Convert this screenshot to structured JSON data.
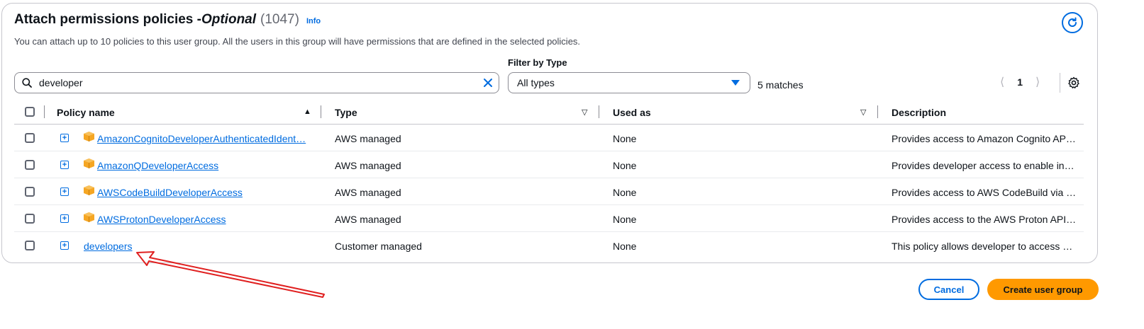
{
  "header": {
    "title": "Attach permissions policies - ",
    "title_optional": "Optional",
    "count": "(1047)",
    "info": "Info",
    "subtitle": "You can attach up to 10 policies to this user group. All the users in this group will have permissions that are defined in the selected policies."
  },
  "filters": {
    "search_value": "developer",
    "filter_label": "Filter by Type",
    "type_selected": "All types",
    "matches": "5 matches"
  },
  "pagination": {
    "current_page": "1"
  },
  "table": {
    "columns": [
      "Policy name",
      "Type",
      "Used as",
      "Description"
    ],
    "rows": [
      {
        "name": "AmazonCognitoDeveloperAuthenticatedIdent…",
        "aws_icon": true,
        "type": "AWS managed",
        "used_as": "None",
        "description": "Provides access to Amazon Cognito AP…"
      },
      {
        "name": "AmazonQDeveloperAccess",
        "aws_icon": true,
        "type": "AWS managed",
        "used_as": "None",
        "description": "Provides developer access to enable in…"
      },
      {
        "name": "AWSCodeBuildDeveloperAccess",
        "aws_icon": true,
        "type": "AWS managed",
        "used_as": "None",
        "description": "Provides access to AWS CodeBuild via …"
      },
      {
        "name": "AWSProtonDeveloperAccess",
        "aws_icon": true,
        "type": "AWS managed",
        "used_as": "None",
        "description": "Provides access to the AWS Proton API…"
      },
      {
        "name": "developers",
        "aws_icon": false,
        "type": "Customer managed",
        "used_as": "None",
        "description": "This policy allows developer to access …"
      }
    ]
  },
  "actions": {
    "cancel": "Cancel",
    "create": "Create user group"
  },
  "colors": {
    "accent": "#006ce0",
    "primary_button": "#ff9900",
    "annotation_arrow": "#e02020",
    "aws_icon": "#f5a623"
  }
}
